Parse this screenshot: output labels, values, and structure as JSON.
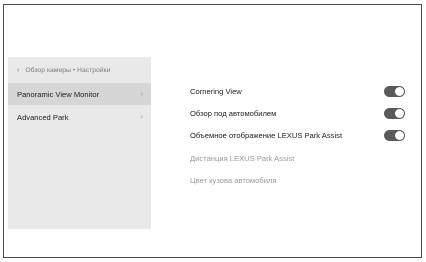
{
  "sidebar": {
    "breadcrumb": "Обзор камеры • Настройки",
    "items": [
      {
        "label": "Panoramic View Monitor",
        "active": true
      },
      {
        "label": "Advanced Park",
        "active": false
      }
    ]
  },
  "settings": [
    {
      "label": "Cornering View",
      "toggle": "on"
    },
    {
      "label": "Обзор под автомобилем",
      "toggle": "on"
    },
    {
      "label": "Объемное отображение LEXUS Park Assist",
      "toggle": "on"
    },
    {
      "label": "Дистанция LEXUS Park Assist",
      "disabled": true
    },
    {
      "label": "Цвет кузова автомобиля",
      "disabled": true
    }
  ]
}
